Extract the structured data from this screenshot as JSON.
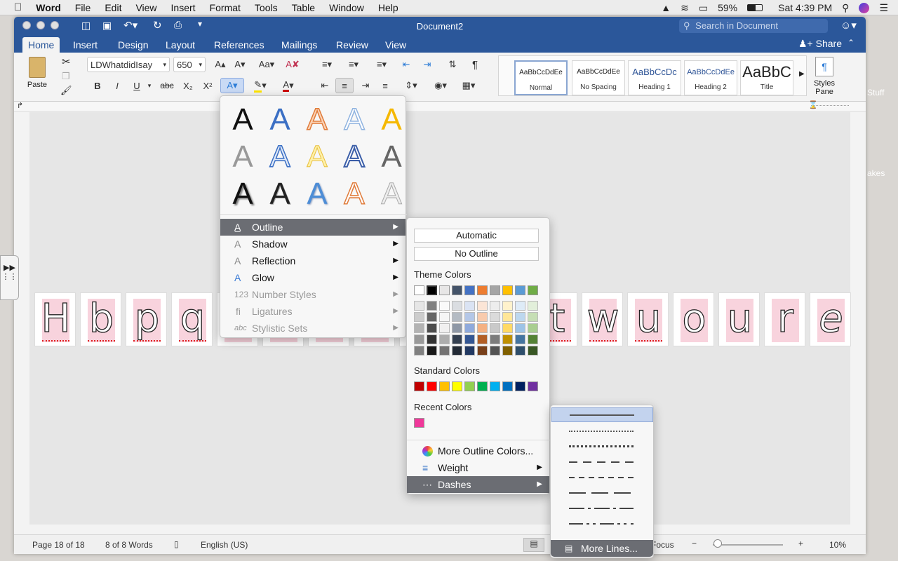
{
  "menubar": {
    "app": "Word",
    "items": [
      "File",
      "Edit",
      "View",
      "Insert",
      "Format",
      "Tools",
      "Table",
      "Window",
      "Help"
    ],
    "battery": "59%",
    "clock": "Sat 4:39 PM"
  },
  "window": {
    "title": "Document2",
    "search_placeholder": "Search in Document",
    "share": "Share"
  },
  "tabs": [
    "Home",
    "Insert",
    "Design",
    "Layout",
    "References",
    "Mailings",
    "Review",
    "View"
  ],
  "ribbon": {
    "paste": "Paste",
    "font_name": "LDWhatdidIsay",
    "font_size": "650",
    "bold": "B",
    "italic": "I",
    "underline": "U",
    "strike": "abc",
    "sub": "X₂",
    "sup": "X²",
    "styles": [
      {
        "preview": "AaBbCcDdEe",
        "label": "Normal"
      },
      {
        "preview": "AaBbCcDdEe",
        "label": "No Spacing"
      },
      {
        "preview": "AaBbCcDc",
        "label": "Heading 1"
      },
      {
        "preview": "AaBbCcDdEe",
        "label": "Heading 2"
      },
      {
        "preview": "AaBbC",
        "label": "Title"
      }
    ],
    "styles_pane": "Styles Pane"
  },
  "cards_left": [
    "H",
    "b",
    "p",
    "q"
  ],
  "cards_right": [
    "t",
    "w",
    "u",
    "o",
    "u",
    "r",
    "e"
  ],
  "sidebar_clip": {
    "top": "Stuff",
    "bottom": "akes"
  },
  "effects_menu": {
    "gallery_glyph": "A",
    "items": [
      {
        "label": "Outline",
        "state": "hl"
      },
      {
        "label": "Shadow",
        "state": ""
      },
      {
        "label": "Reflection",
        "state": ""
      },
      {
        "label": "Glow",
        "state": ""
      },
      {
        "label": "Number Styles",
        "state": "dis"
      },
      {
        "label": "Ligatures",
        "state": "dis"
      },
      {
        "label": "Stylistic Sets",
        "state": "dis"
      }
    ]
  },
  "outline_menu": {
    "automatic": "Automatic",
    "no_outline": "No Outline",
    "theme_title": "Theme Colors",
    "standard_title": "Standard Colors",
    "recent_title": "Recent Colors",
    "theme_colors": [
      "#ffffff",
      "#000000",
      "#e7e6e6",
      "#44546a",
      "#4472c4",
      "#ed7d31",
      "#a5a5a5",
      "#ffc000",
      "#5b9bd5",
      "#70ad47"
    ],
    "standard_colors": [
      "#c00000",
      "#ff0000",
      "#ffc000",
      "#ffff00",
      "#92d050",
      "#00b050",
      "#00b0f0",
      "#0070c0",
      "#002060",
      "#7030a0"
    ],
    "recent_colors": [
      "#f0389a"
    ],
    "more_colors": "More Outline Colors...",
    "weight": "Weight",
    "dashes": "Dashes"
  },
  "dashes_menu": {
    "more_lines": "More Lines..."
  },
  "status": {
    "page": "Page 18 of 18",
    "words": "8 of 8 Words",
    "language": "English (US)",
    "focus": "Focus",
    "zoom": "10%"
  }
}
